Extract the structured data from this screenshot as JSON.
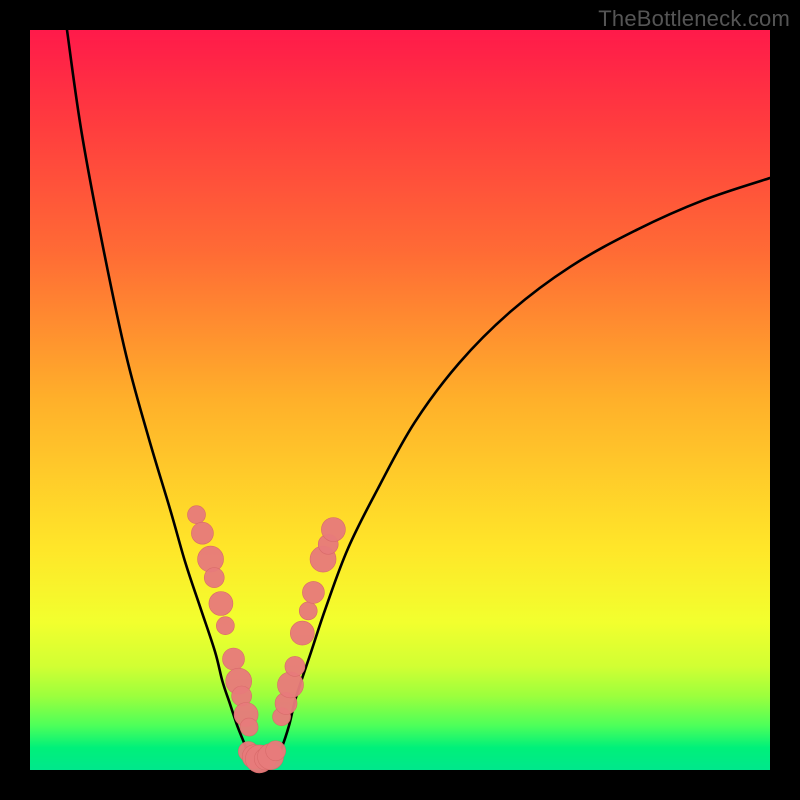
{
  "watermark": "TheBottleneck.com",
  "colors": {
    "background": "#000000",
    "curve_stroke": "#000000",
    "dot_fill": "#e77b7b",
    "dot_stroke": "#d86a6a",
    "gradient_top": "#ff1a4a",
    "gradient_bottom": "#00e78c"
  },
  "chart_data": {
    "type": "line",
    "title": "",
    "xlabel": "",
    "ylabel": "",
    "xlim": [
      0,
      100
    ],
    "ylim": [
      0,
      100
    ],
    "grid": false,
    "legend": false,
    "series": [
      {
        "name": "left-branch",
        "x": [
          5,
          7,
          10,
          13,
          16,
          19,
          21,
          23,
          25,
          26,
          27,
          28,
          29,
          29.5,
          30
        ],
        "y": [
          100,
          86,
          70,
          56,
          45,
          35,
          28,
          22,
          16,
          12,
          9,
          6,
          3.5,
          2,
          1
        ]
      },
      {
        "name": "right-branch",
        "x": [
          33,
          34,
          35,
          36,
          38,
          40,
          43,
          47,
          52,
          58,
          65,
          73,
          82,
          91,
          100
        ],
        "y": [
          1,
          3,
          6,
          10,
          16,
          22,
          30,
          38,
          47,
          55,
          62,
          68,
          73,
          77,
          80
        ]
      },
      {
        "name": "valley-floor",
        "x": [
          29.5,
          30,
          31,
          32,
          33
        ],
        "y": [
          1.5,
          1.0,
          0.8,
          1.0,
          1.5
        ]
      }
    ],
    "dots_left_branch": [
      {
        "x": 22.5,
        "y": 34.5
      },
      {
        "x": 23.3,
        "y": 32.0
      },
      {
        "x": 24.4,
        "y": 28.5
      },
      {
        "x": 24.9,
        "y": 26.0
      },
      {
        "x": 25.8,
        "y": 22.5
      },
      {
        "x": 26.4,
        "y": 19.5
      },
      {
        "x": 27.5,
        "y": 15.0
      },
      {
        "x": 28.2,
        "y": 12.0
      },
      {
        "x": 28.6,
        "y": 10.0
      },
      {
        "x": 29.2,
        "y": 7.5
      },
      {
        "x": 29.6,
        "y": 5.8
      }
    ],
    "dots_right_branch": [
      {
        "x": 34.0,
        "y": 7.2
      },
      {
        "x": 34.6,
        "y": 9.0
      },
      {
        "x": 35.2,
        "y": 11.5
      },
      {
        "x": 35.8,
        "y": 14.0
      },
      {
        "x": 36.8,
        "y": 18.5
      },
      {
        "x": 37.6,
        "y": 21.5
      },
      {
        "x": 38.3,
        "y": 24.0
      },
      {
        "x": 39.6,
        "y": 28.5
      },
      {
        "x": 40.3,
        "y": 30.5
      },
      {
        "x": 41.0,
        "y": 32.5
      }
    ],
    "dots_valley": [
      {
        "x": 29.5,
        "y": 2.5
      },
      {
        "x": 30.3,
        "y": 1.8
      },
      {
        "x": 31.0,
        "y": 1.5
      },
      {
        "x": 31.8,
        "y": 1.5
      },
      {
        "x": 32.5,
        "y": 1.8
      },
      {
        "x": 33.2,
        "y": 2.6
      }
    ],
    "dot_radius_range": [
      7,
      14
    ]
  }
}
